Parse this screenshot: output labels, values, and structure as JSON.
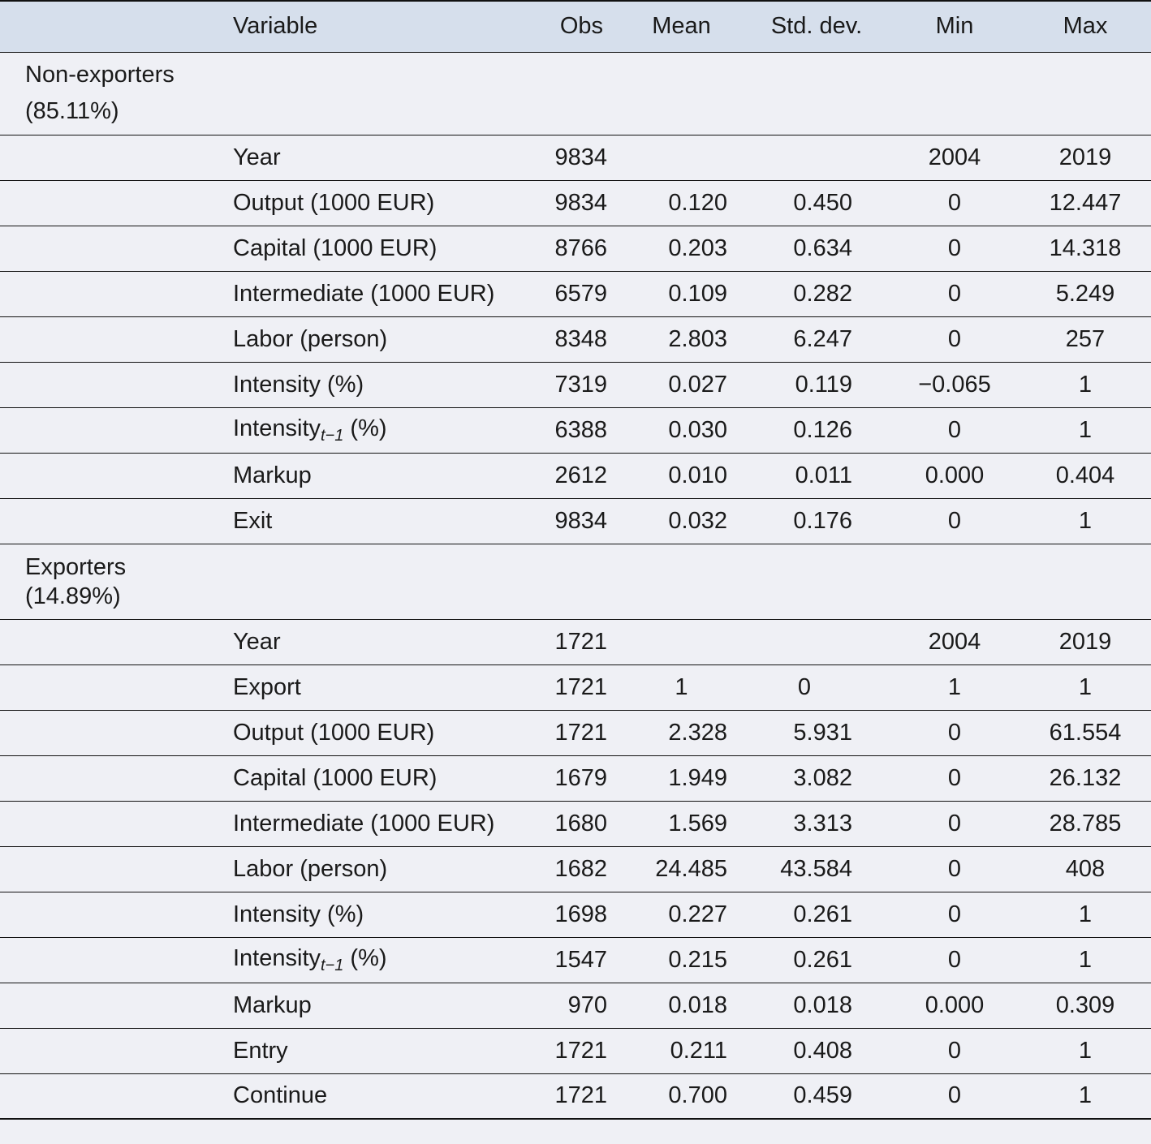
{
  "header": {
    "variable": "Variable",
    "obs": "Obs",
    "mean": "Mean",
    "sd": "Std. dev.",
    "min": "Min",
    "max": "Max"
  },
  "groups": [
    {
      "label_line1": "Non-exporters",
      "label_line2": "(85.11%)",
      "rows": [
        {
          "variable": "Year",
          "obs": "9834",
          "mean": "",
          "sd": "",
          "min": "2004",
          "max": "2019"
        },
        {
          "variable": "Output (1000 EUR)",
          "obs": "9834",
          "mean": "0.120",
          "sd": "0.450",
          "min": "0",
          "max": "12.447"
        },
        {
          "variable": "Capital (1000 EUR)",
          "obs": "8766",
          "mean": "0.203",
          "sd": "0.634",
          "min": "0",
          "max": "14.318"
        },
        {
          "variable": "Intermediate (1000 EUR)",
          "obs": "6579",
          "mean": "0.109",
          "sd": "0.282",
          "min": "0",
          "max": "5.249"
        },
        {
          "variable": "Labor (person)",
          "obs": "8348",
          "mean": "2.803",
          "sd": "6.247",
          "min": "0",
          "max": "257"
        },
        {
          "variable": "Intensity (%)",
          "obs": "7319",
          "mean": "0.027",
          "sd": "0.119",
          "min": "−0.065",
          "max": "1"
        },
        {
          "variable": "Intensity",
          "variable_sub": "t−1",
          "variable_suffix": " (%)",
          "obs": "6388",
          "mean": "0.030",
          "sd": "0.126",
          "min": "0",
          "max": "1"
        },
        {
          "variable": "Markup",
          "obs": "2612",
          "mean": "0.010",
          "sd": "0.011",
          "min": "0.000",
          "max": "0.404"
        },
        {
          "variable": "Exit",
          "obs": "9834",
          "mean": "0.032",
          "sd": "0.176",
          "min": "0",
          "max": "1"
        }
      ]
    },
    {
      "label_line1": "Exporters",
      "label_line2": "(14.89%)",
      "rows": [
        {
          "variable": "Year",
          "obs": "1721",
          "mean": "",
          "sd": "",
          "min": "2004",
          "max": "2019"
        },
        {
          "variable": "Export",
          "obs": "1721",
          "mean": "1",
          "sd": "0",
          "min": "1",
          "max": "1",
          "centered": true
        },
        {
          "variable": "Output (1000 EUR)",
          "obs": "1721",
          "mean": "2.328",
          "sd": "5.931",
          "min": "0",
          "max": "61.554"
        },
        {
          "variable": "Capital (1000 EUR)",
          "obs": "1679",
          "mean": "1.949",
          "sd": "3.082",
          "min": "0",
          "max": "26.132"
        },
        {
          "variable": "Intermediate (1000 EUR)",
          "obs": "1680",
          "mean": "1.569",
          "sd": "3.313",
          "min": "0",
          "max": "28.785"
        },
        {
          "variable": "Labor (person)",
          "obs": "1682",
          "mean": "24.485",
          "sd": "43.584",
          "min": "0",
          "max": "408"
        },
        {
          "variable": "Intensity (%)",
          "obs": "1698",
          "mean": "0.227",
          "sd": "0.261",
          "min": "0",
          "max": "1"
        },
        {
          "variable": "Intensity",
          "variable_sub": "t−1",
          "variable_suffix": " (%)",
          "obs": "1547",
          "mean": "0.215",
          "sd": "0.261",
          "min": "0",
          "max": "1"
        },
        {
          "variable": "Markup",
          "obs": "970",
          "mean": "0.018",
          "sd": "0.018",
          "min": "0.000",
          "max": "0.309"
        },
        {
          "variable": "Entry",
          "obs": "1721",
          "mean": "0.211",
          "sd": "0.408",
          "min": "0",
          "max": "1"
        },
        {
          "variable": "Continue",
          "obs": "1721",
          "mean": "0.700",
          "sd": "0.459",
          "min": "0",
          "max": "1"
        }
      ]
    }
  ]
}
